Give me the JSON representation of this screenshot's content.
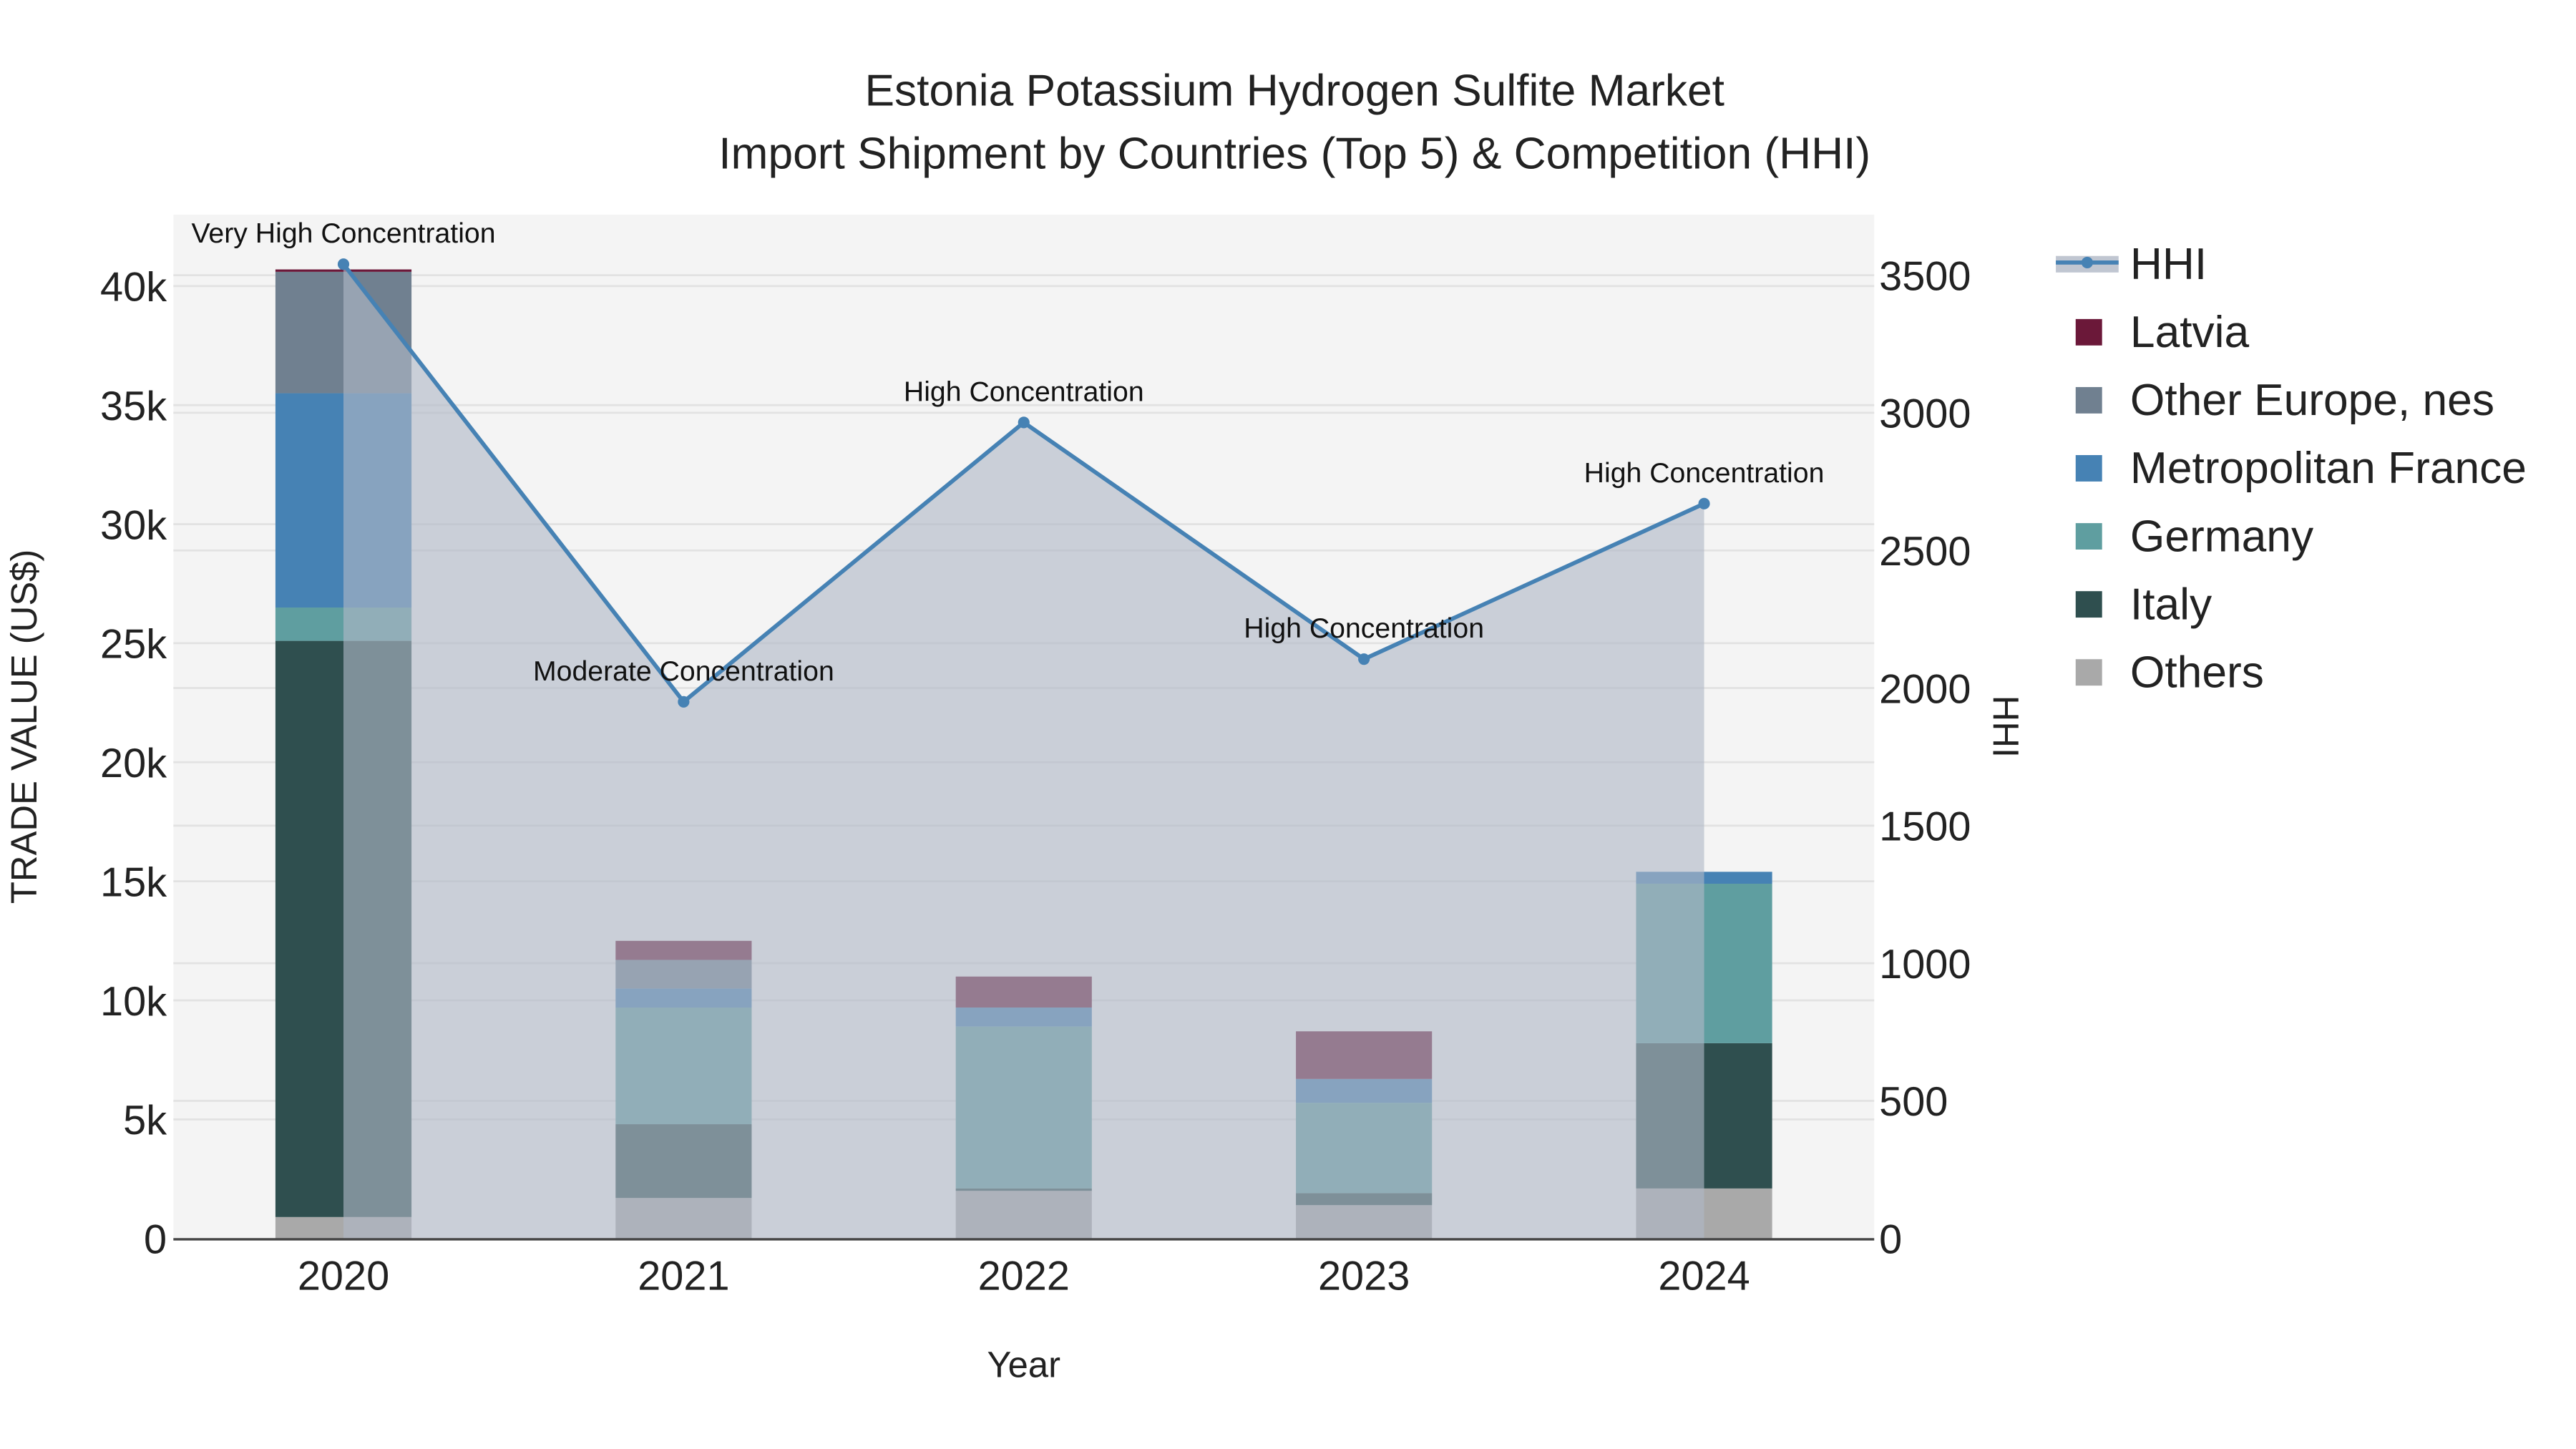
{
  "chart_data": {
    "type": "bar",
    "title_line1": "Estonia Potassium Hydrogen Sulfite Market",
    "title_line2": "Import Shipment by Countries (Top 5) & Competition (HHI)",
    "xlabel": "Year",
    "ylabel": "TRADE VALUE (US$)",
    "y2label": "HHI",
    "categories": [
      "2020",
      "2021",
      "2022",
      "2023",
      "2024"
    ],
    "ylim": [
      0,
      43000
    ],
    "y2lim": [
      0,
      3720
    ],
    "yticks": [
      0,
      5000,
      10000,
      15000,
      20000,
      25000,
      30000,
      35000,
      40000
    ],
    "ytick_labels": [
      "0",
      "5k",
      "10k",
      "15k",
      "20k",
      "25k",
      "30k",
      "35k",
      "40k"
    ],
    "y2ticks": [
      0,
      500,
      1000,
      1500,
      2000,
      2500,
      3000,
      3500
    ],
    "y2tick_labels": [
      "0",
      "500",
      "1000",
      "1500",
      "2000",
      "2500",
      "3000",
      "3500"
    ],
    "series": [
      {
        "name": "Others",
        "color": "#A9A9A9",
        "values": [
          900,
          1700,
          2000,
          1400,
          2100
        ]
      },
      {
        "name": "Italy",
        "color": "#2F4F4F",
        "values": [
          24200,
          3100,
          100,
          500,
          6100
        ]
      },
      {
        "name": "Germany",
        "color": "#5F9EA0",
        "values": [
          1400,
          4900,
          6800,
          3800,
          6700
        ]
      },
      {
        "name": "Metropolitan France",
        "color": "#4682B4",
        "values": [
          9000,
          800,
          800,
          1000,
          500
        ]
      },
      {
        "name": "Other Europe, nes",
        "color": "#708090",
        "values": [
          5100,
          1200,
          0,
          0,
          0
        ]
      },
      {
        "name": "Latvia",
        "color": "#6B1839",
        "values": [
          100,
          800,
          1300,
          2000,
          0
        ]
      }
    ],
    "hhi": {
      "name": "HHI",
      "color": "#4682B4",
      "values": [
        3540,
        1950,
        2965,
        2105,
        2670
      ],
      "annotations": [
        "Very High Concentration",
        "Moderate Concentration",
        "High Concentration",
        "High Concentration",
        "High Concentration"
      ]
    },
    "legend": [
      "HHI",
      "Latvia",
      "Other Europe, nes",
      "Metropolitan France",
      "Germany",
      "Italy",
      "Others"
    ],
    "legend_placement": "right",
    "grid": true
  }
}
